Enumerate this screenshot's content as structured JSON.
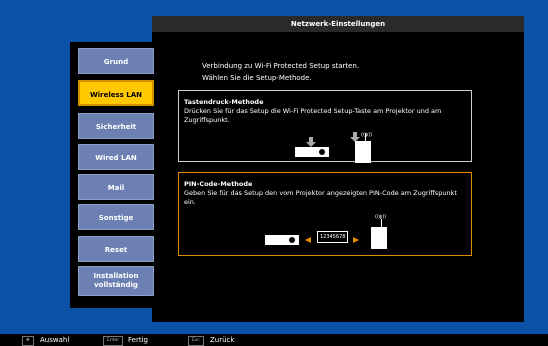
{
  "title": "Netzwerk-Einstellungen",
  "menu": [
    {
      "label": "Grund"
    },
    {
      "label": "Wireless LAN"
    },
    {
      "label": "Sicherheit"
    },
    {
      "label": "Wired LAN"
    },
    {
      "label": "Mail"
    },
    {
      "label": "Sonstige"
    },
    {
      "label": "Reset"
    },
    {
      "label": "Installation\nvollständig"
    }
  ],
  "intro": {
    "line1": "Verbindung zu Wi-Fi Protected Setup starten.",
    "line2": "Wählen Sie die Setup-Methode."
  },
  "push_method": {
    "heading": "Tastendruck-Methode",
    "text": "Drücken Sie für das Setup die Wi-Fi Protected Setup-Taste am Projektor und am Zugriffspunkt.",
    "signal": "((ψ))"
  },
  "pin_method": {
    "heading": "PIN-Code-Methode",
    "text": "Geben Sie für das Setup den vom Projektor angezeigten PIN-Code am Zugriffspunkt ein.",
    "code": "12345678",
    "signal": "((ψ))"
  },
  "footer": {
    "select_key": "✥",
    "select_label": "Auswahl",
    "enter_key": "Enter",
    "enter_label": "Fertig",
    "esc_key": "Esc",
    "esc_label": "Zurück"
  }
}
